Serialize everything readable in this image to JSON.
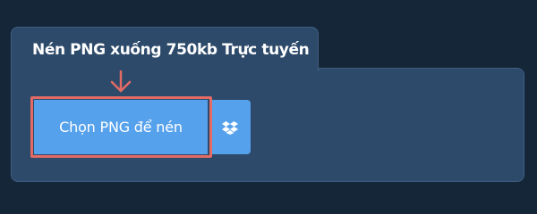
{
  "tab": {
    "title": "Nén PNG xuống 750kb Trực tuyến"
  },
  "upload": {
    "label": "Chọn PNG để nén"
  },
  "icons": {
    "arrow": "arrow-down-icon",
    "dropbox": "dropbox-icon"
  },
  "colors": {
    "page_background": "#152639",
    "panel": "#2d4a6a",
    "button": "#56a1ec",
    "highlight": "#e36b64"
  }
}
